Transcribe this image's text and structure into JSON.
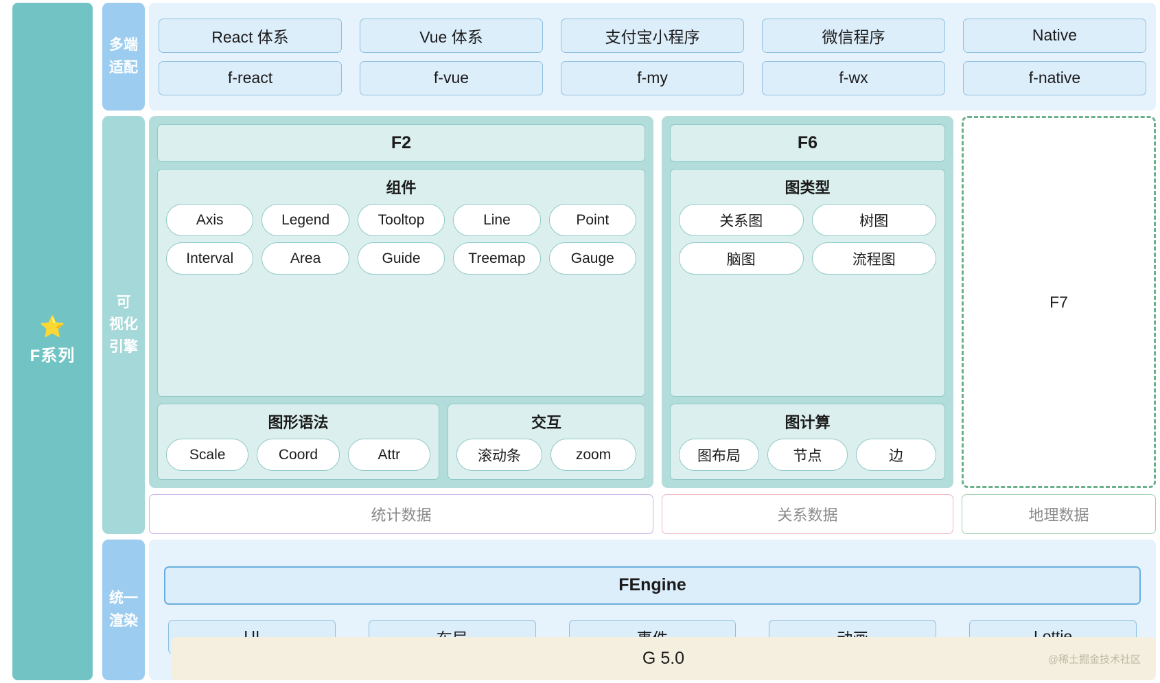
{
  "brand": {
    "star_icon": "⭐",
    "label": "F系列"
  },
  "stages": {
    "multi_platform": "多端\n适配",
    "visualization": "可\n视化\n引擎",
    "render": "统一\n渲染"
  },
  "multi_platform": {
    "platforms": [
      "React 体系",
      "Vue 体系",
      "支付宝小程序",
      "微信程序",
      "Native"
    ],
    "packages": [
      "f-react",
      "f-vue",
      "f-my",
      "f-wx",
      "f-native"
    ]
  },
  "f2": {
    "title": "F2",
    "components": {
      "title": "组件",
      "row1": [
        "Axis",
        "Legend",
        "Tooltop",
        "Line",
        "Point"
      ],
      "row2": [
        "Interval",
        "Area",
        "Guide",
        "Treemap",
        "Gauge"
      ]
    },
    "grammar": {
      "title": "图形语法",
      "items": [
        "Scale",
        "Coord",
        "Attr"
      ]
    },
    "interaction": {
      "title": "交互",
      "items": [
        "滚动条",
        "zoom"
      ]
    }
  },
  "f6": {
    "title": "F6",
    "graph_types": {
      "title": "图类型",
      "row1": [
        "关系图",
        "树图"
      ],
      "row2": [
        "脑图",
        "流程图"
      ]
    },
    "graph_compute": {
      "title": "图计算",
      "items": [
        "图布局",
        "节点",
        "边"
      ]
    }
  },
  "f7": {
    "title": "F7"
  },
  "data_layer": {
    "statistic": "统计数据",
    "relational": "关系数据",
    "geographic": "地理数据"
  },
  "render_layer": {
    "engine": "FEngine",
    "modules": [
      "UI",
      "布局",
      "事件",
      "动画",
      "Lottie"
    ]
  },
  "footer": {
    "label": "G 5.0",
    "watermark": "@稀土掘金技术社区"
  },
  "colors": {
    "brand_teal": "#72c4c4",
    "stage_blue": "#9ccdf0",
    "stage_teal": "#a5d8d8",
    "band_blue_bg": "#e7f3fc",
    "engine_teal": "#b2ddda",
    "subcard_teal": "#dbf0ee",
    "chip_blue": "#ddeefb",
    "chip_border": "#8fbfdf",
    "pill_border": "#8fc9c5",
    "f7_dash": "#6ab08a",
    "stat_border": "#c9aee8",
    "rel_border": "#eeb3bd",
    "geo_border": "#9ccfaa",
    "footer_bg": "#f5efdf"
  }
}
